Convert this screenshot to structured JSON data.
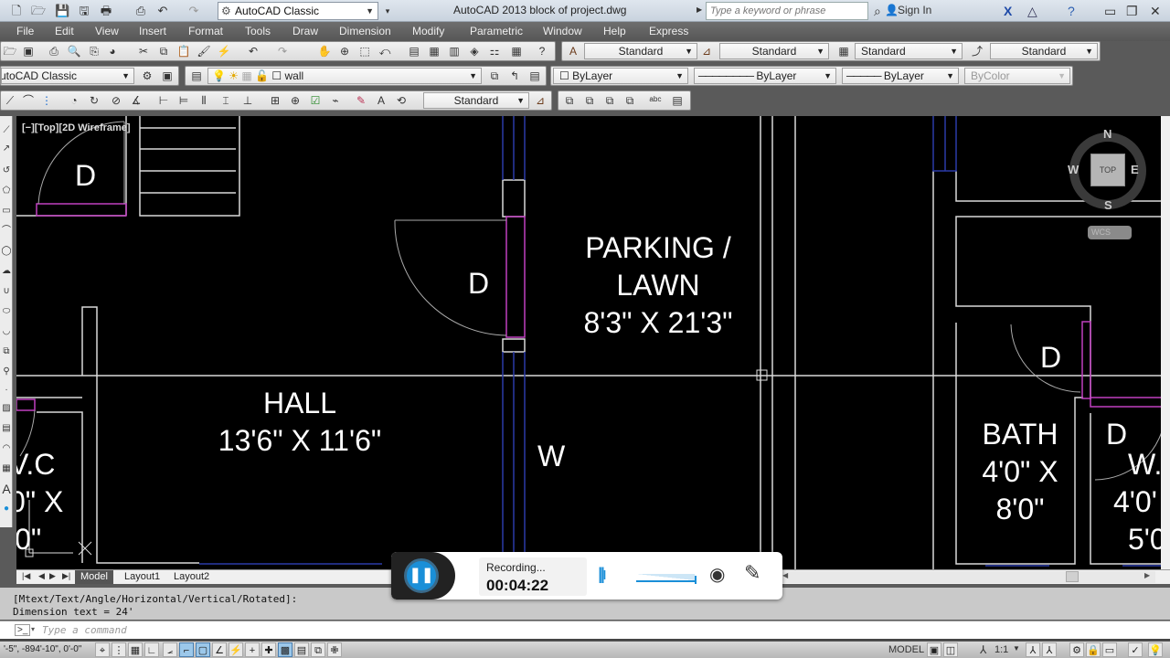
{
  "titlebar": {
    "workspace": "AutoCAD Classic",
    "title": "AutoCAD 2013    block of project.dwg",
    "search_placeholder": "Type a keyword or phrase",
    "sign_in": "Sign In"
  },
  "menu": [
    "File",
    "Edit",
    "View",
    "Insert",
    "Format",
    "Tools",
    "Draw",
    "Dimension",
    "Modify",
    "Parametric",
    "Window",
    "Help",
    "Express"
  ],
  "styles_toolbar": {
    "text_style": "Standard",
    "dim_style": "Standard",
    "table_style": "Standard",
    "multileader_style": "Standard"
  },
  "workspace_toolbar": {
    "workspace": "AutoCAD Classic"
  },
  "layers_toolbar": {
    "current_layer": "wall"
  },
  "properties_toolbar": {
    "color": "ByLayer",
    "linetype": "ByLayer",
    "lineweight": "ByLayer",
    "plotstyle": "ByColor"
  },
  "dimension_toolbar": {
    "dim_style": "Standard"
  },
  "viewport": {
    "label": "[−][Top][2D Wireframe]",
    "viewcube": {
      "top": "TOP",
      "n": "N",
      "s": "S",
      "e": "E",
      "w": "W",
      "ucs": "WCS"
    }
  },
  "drawing": {
    "rooms": [
      {
        "id": "door-top-left",
        "lines": [
          "D"
        ]
      },
      {
        "id": "door-center",
        "lines": [
          "D"
        ]
      },
      {
        "id": "parking",
        "lines": [
          "PARKING /",
          "LAWN",
          "8'3\" X 21'3\""
        ]
      },
      {
        "id": "hall",
        "lines": [
          "HALL",
          "13'6\" X 11'6\""
        ]
      },
      {
        "id": "window",
        "lines": [
          "W"
        ]
      },
      {
        "id": "wc-left",
        "lines": [
          "V.C",
          "0\" X",
          "'0\""
        ]
      },
      {
        "id": "door-right",
        "lines": [
          "D"
        ]
      },
      {
        "id": "bath",
        "lines": [
          "BATH",
          "4'0\" X",
          "8'0\""
        ]
      },
      {
        "id": "door-right2",
        "lines": [
          "D"
        ]
      },
      {
        "id": "wc-right",
        "lines": [
          "W.",
          "4'0'",
          "5'0"
        ]
      }
    ]
  },
  "tabs": {
    "items": [
      "Model",
      "Layout1",
      "Layout2"
    ],
    "active": "Model"
  },
  "command": {
    "history": [
      "[Mtext/Text/Angle/Horizontal/Vertical/Rotated]:",
      "Dimension text = 24'"
    ],
    "placeholder": "Type a command"
  },
  "status": {
    "coordinates": "'-5\", -894'-10\", 0'-0\"",
    "model": "MODEL",
    "annotation_scale": "1:1"
  },
  "recorder": {
    "status": "Recording...",
    "elapsed": "00:04:22"
  },
  "colors": {
    "canvas": "#000000",
    "wall": "#d9d9d9",
    "door": "#c040c0",
    "window": "#2a3aa8",
    "recorder_accent": "#1a8fd8"
  }
}
